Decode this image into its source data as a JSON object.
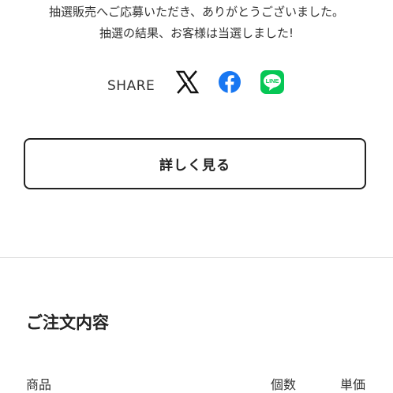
{
  "message": {
    "line1": "抽選販売へご応募いただき、ありがとうございました。",
    "line2": "抽選の結果、お客様は当選しました!"
  },
  "share": {
    "label": "SHARE",
    "icons": [
      "x-logo-icon",
      "facebook-icon",
      "line-icon"
    ],
    "colors": {
      "facebook": "#1877F2",
      "line": "#06C755",
      "x": "#111111"
    },
    "line_icon_text": "LINE"
  },
  "details_button": {
    "label": "詳しく見る"
  },
  "order": {
    "title": "ご注文内容",
    "columns": {
      "product": "商品",
      "quantity": "個数",
      "price": "単価"
    }
  }
}
